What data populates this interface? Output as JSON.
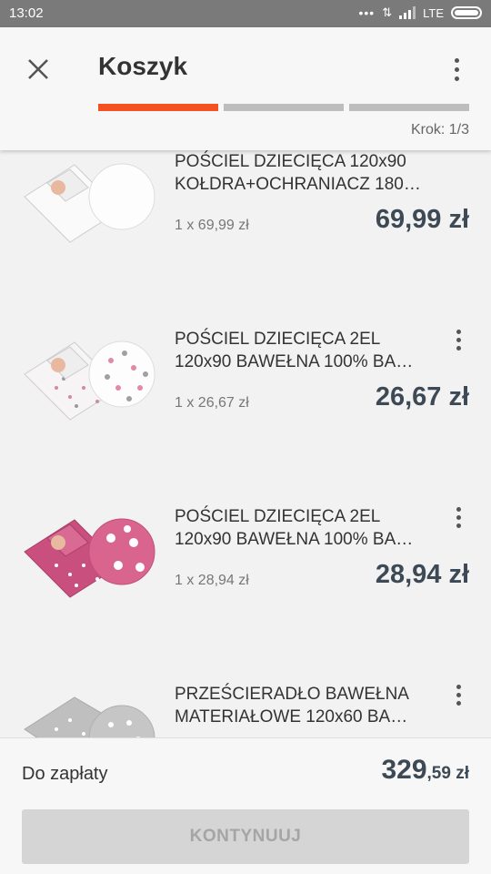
{
  "status_bar": {
    "time": "13:02",
    "network": "LTE"
  },
  "header": {
    "title": "Koszyk",
    "step_label": "Krok: 1/3",
    "accent_color": "#f4511e"
  },
  "cart": {
    "items": [
      {
        "name": "POŚCIEL DZIECIĘCA 120x90\nKOŁDRA+OCHRANIACZ 180…",
        "qty_price": "1 x 69,99 zł",
        "total": "69,99 zł"
      },
      {
        "name": "POŚCIEL DZIECIĘCA 2EL\n120x90 BAWEŁNA 100% BA…",
        "qty_price": "1 x 26,67 zł",
        "total": "26,67 zł"
      },
      {
        "name": "POŚCIEL DZIECIĘCA 2EL\n120x90 BAWEŁNA 100% BA…",
        "qty_price": "1 x 28,94 zł",
        "total": "28,94 zł"
      },
      {
        "name": "PRZEŚCIERADŁO BAWEŁNA\nMATERIAŁOWE 120x60 BA…",
        "qty_price": "",
        "total": ""
      }
    ]
  },
  "footer": {
    "total_label": "Do zapłaty",
    "total_integer": "329",
    "total_fraction": ",59 zł",
    "continue_label": "KONTYNUUJ"
  }
}
